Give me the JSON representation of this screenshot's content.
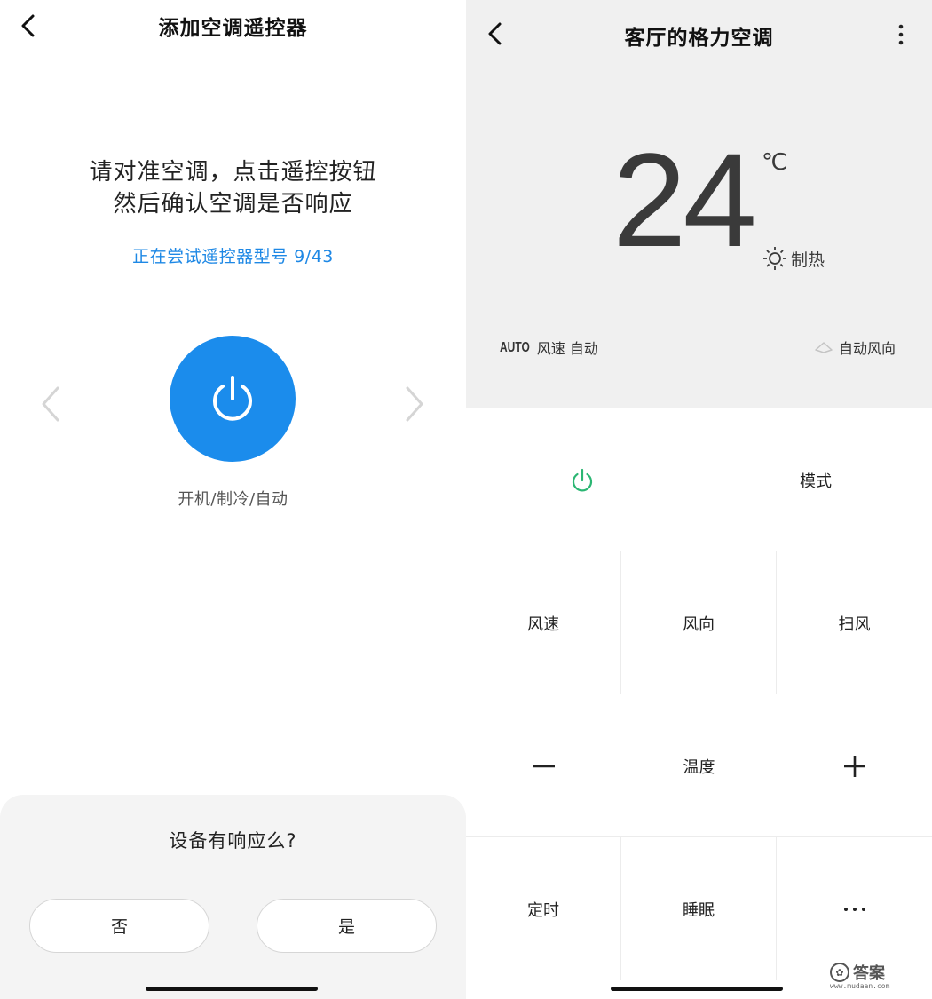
{
  "left_screen": {
    "title": "添加空调遥控器",
    "instruction_line1": "请对准空调，点击遥控按钮",
    "instruction_line2": "然后确认空调是否响应",
    "trying_status": "正在尝试遥控器型号 9/43",
    "power_label": "开机/制冷/自动",
    "sheet": {
      "question": "设备有响应么?",
      "no_label": "否",
      "yes_label": "是"
    },
    "accent_color": "#1b8cec"
  },
  "right_screen": {
    "title": "客厅的格力空调",
    "temperature": "24",
    "unit": "℃",
    "mode": "制热",
    "fan_tag": "AUTO",
    "fan_status": "风速 自动",
    "swing_status": "自动风向",
    "buttons": {
      "mode": "模式",
      "fan_speed": "风速",
      "fan_direction": "风向",
      "sweep": "扫风",
      "temperature": "温度",
      "timer": "定时",
      "sleep": "睡眠"
    },
    "power_color": "#2bb673"
  },
  "watermark": {
    "text": "答案",
    "url": "www.mudaan.com"
  }
}
